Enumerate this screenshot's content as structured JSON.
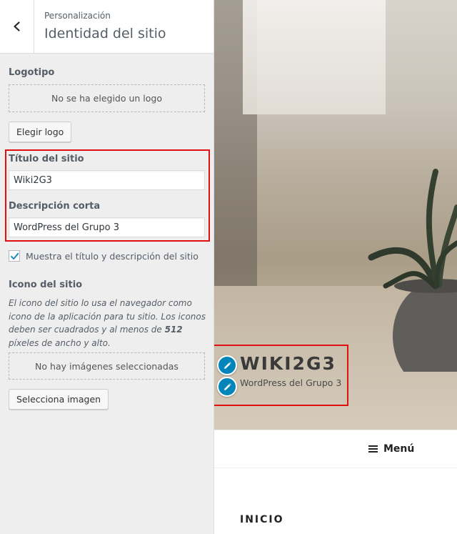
{
  "panel": {
    "breadcrumb": "Personalización",
    "title": "Identidad del sitio"
  },
  "logo": {
    "label": "Logotipo",
    "placeholder_text": "No se ha elegido un logo",
    "button_label": "Elegir logo"
  },
  "site_title": {
    "label": "Título del sitio",
    "value": "Wiki2G3"
  },
  "tagline": {
    "label": "Descripción corta",
    "value": "WordPress del Grupo 3"
  },
  "display_title_checkbox": {
    "checked": true,
    "label": "Muestra el título y descripción del sitio"
  },
  "site_icon": {
    "label": "Icono del sitio",
    "description_part1": "El icono del sitio lo usa el navegador como icono de la aplicación para tu sitio. Los iconos deben ser cuadrados y al menos de ",
    "description_bold": "512",
    "description_part2": " píxeles de ancho y alto.",
    "placeholder_text": "No hay imágenes seleccionadas",
    "button_label": "Selecciona imagen"
  },
  "preview": {
    "site_title": "WIKI2G3",
    "site_description": "WordPress del Grupo 3",
    "menu_label": "Menú",
    "section_heading": "INICIO"
  },
  "colors": {
    "highlight_red": "#e01010",
    "edit_shortcut_blue": "#0085ba",
    "checkbox_check": "#1e8cbe"
  },
  "icons": {
    "back": "chevron-left-icon",
    "check": "checkmark-icon",
    "edit": "pencil-icon",
    "menu": "hamburger-icon"
  }
}
